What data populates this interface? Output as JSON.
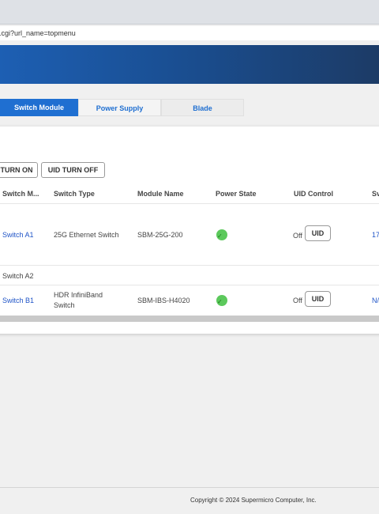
{
  "browser": {
    "url": ".cgi?url_name=topmenu"
  },
  "tabs": [
    "Switch Module",
    "Power Supply",
    "Blade"
  ],
  "toolbar": {
    "uid_on_label": "TURN ON",
    "uid_off_label": "UID TURN OFF"
  },
  "table": {
    "columns": [
      "Switch M...",
      "Switch Type",
      "Module Name",
      "Power State",
      "UID Control",
      "Sv"
    ],
    "rows": [
      {
        "switch": "Switch A1",
        "type_line1": "25G Ethernet Switch",
        "type_line2": "",
        "module": "SBM-25G-200",
        "power": "on",
        "uid_state": "Off",
        "uid_label": "UID",
        "extra": "17"
      },
      {
        "switch": "Switch A2",
        "type_line1": "",
        "type_line2": "",
        "module": "",
        "power": "",
        "uid_state": "",
        "uid_label": "",
        "extra": ""
      },
      {
        "switch": "Switch B1",
        "type_line1": "HDR InfiniBand",
        "type_line2": "Switch",
        "module": "SBM-IBS-H4020",
        "power": "on",
        "uid_state": "Off",
        "uid_label": "UID",
        "extra": "N/"
      }
    ]
  },
  "footer": {
    "copyright": "Copyright © 2024 Supermicro Computer, Inc."
  },
  "colors": {
    "accent": "#1f6fd1",
    "link": "#1f54c7",
    "power_on": "#5cc95c",
    "banner": "#1a4f93"
  }
}
